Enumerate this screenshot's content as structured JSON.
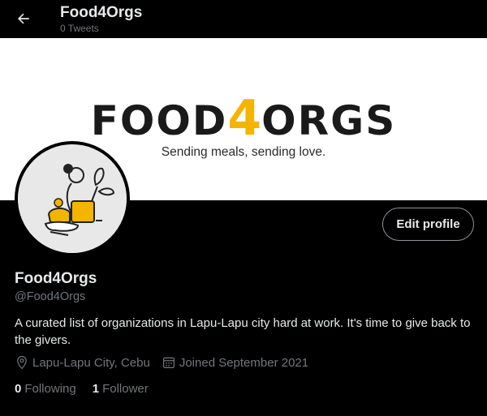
{
  "header": {
    "title": "Food4Orgs",
    "tweet_count": "0 Tweets"
  },
  "banner": {
    "logo_left": "FOOD",
    "logo_accent": "4",
    "logo_right": "ORGS",
    "tagline": "Sending meals, sending love.",
    "accent_color": "#f5b400"
  },
  "profile": {
    "edit_button": "Edit profile",
    "name": "Food4Orgs",
    "handle": "@Food4Orgs",
    "bio": "A curated list of organizations in Lapu-Lapu city hard at work. It's time to give back to the givers.",
    "location": "Lapu-Lapu City, Cebu",
    "joined": "Joined September 2021"
  },
  "stats": {
    "following_count": "0",
    "following_label": "Following",
    "followers_count": "1",
    "followers_label": "Follower"
  },
  "icons": [
    "back-arrow-icon",
    "location-pin-icon",
    "calendar-icon"
  ]
}
